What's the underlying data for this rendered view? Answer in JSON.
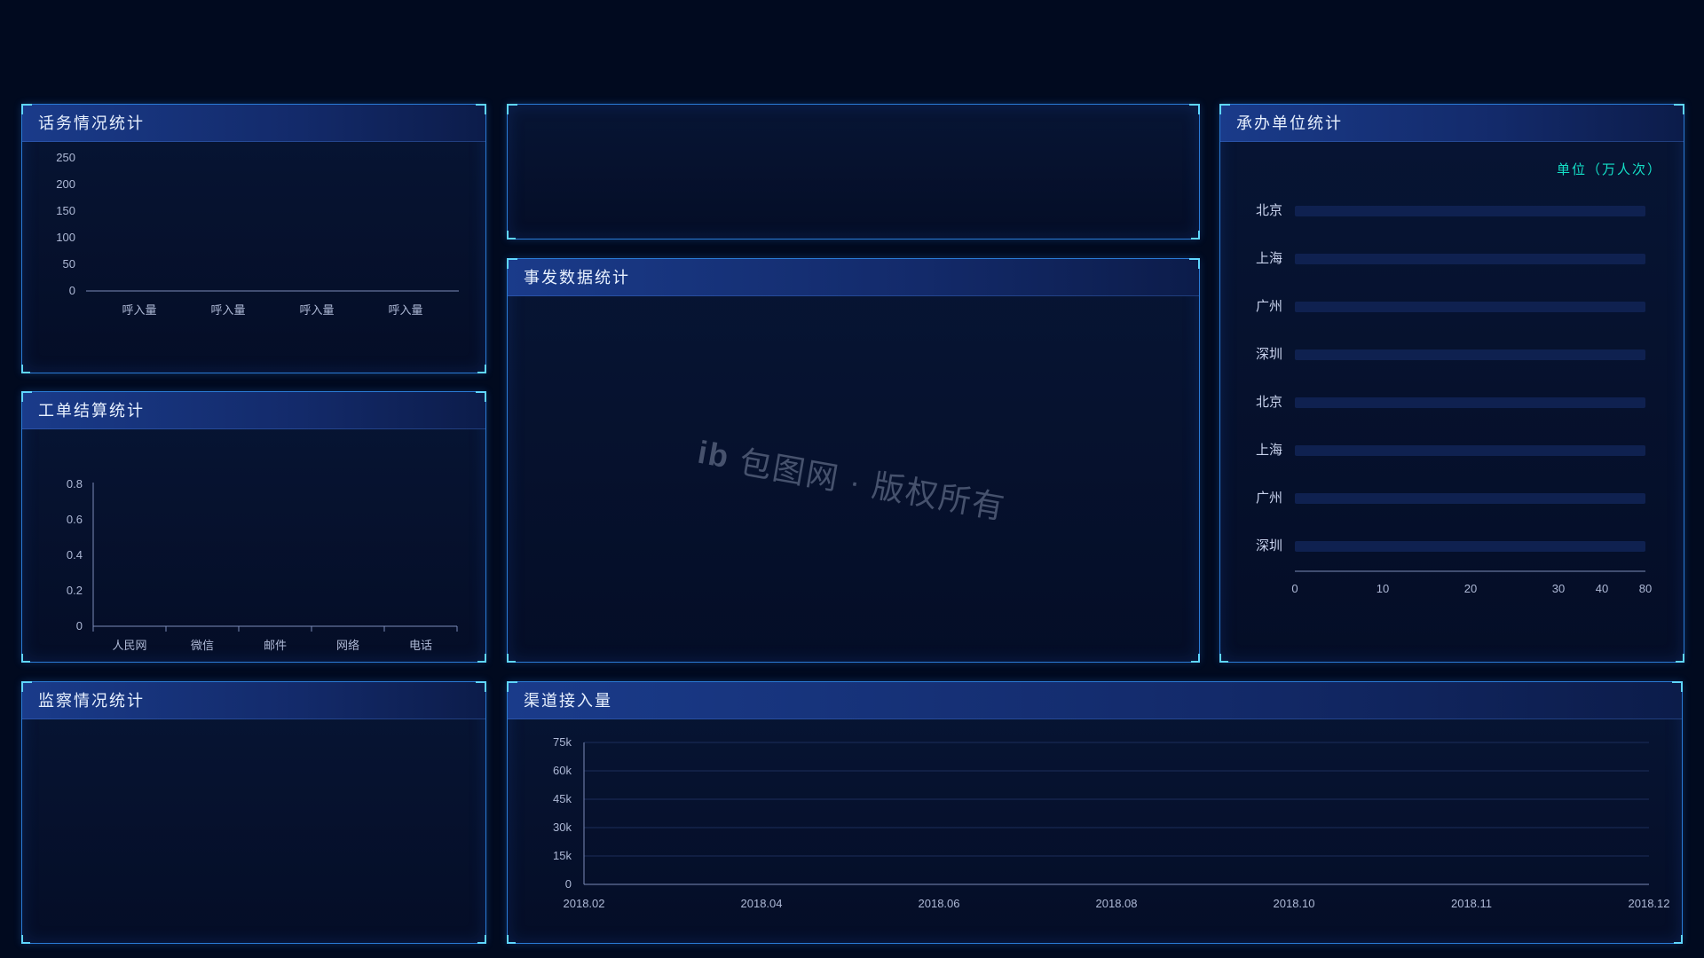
{
  "panels": {
    "call_stats": {
      "title": "话务情况统计"
    },
    "ticket_stats": {
      "title": "工单结算统计"
    },
    "monitor": {
      "title": "监察情况统计"
    },
    "top_center": {
      "title": ""
    },
    "incident": {
      "title": "事发数据统计"
    },
    "channel": {
      "title": "渠道接入量"
    },
    "agency": {
      "title": "承办单位统计",
      "unit_label": "单位（万人次）"
    }
  },
  "watermark": "包图网 · 版权所有",
  "chart_data": [
    {
      "id": "call_stats",
      "type": "bar",
      "categories": [
        "呼入量",
        "呼入量",
        "呼入量",
        "呼入量"
      ],
      "values": [
        0,
        0,
        0,
        0
      ],
      "ylabel": "",
      "xlabel": "",
      "yticks": [
        0,
        50,
        100,
        150,
        200,
        250
      ],
      "ylim": [
        0,
        250
      ]
    },
    {
      "id": "ticket_stats",
      "type": "bar",
      "categories": [
        "人民网",
        "微信",
        "邮件",
        "网络",
        "电话"
      ],
      "values": [
        0,
        0,
        0,
        0,
        0
      ],
      "yticks": [
        0.0,
        0.2,
        0.4,
        0.6,
        0.8
      ],
      "ylim": [
        0,
        0.8
      ]
    },
    {
      "id": "agency",
      "type": "bar",
      "orientation": "horizontal",
      "categories": [
        "北京",
        "上海",
        "广州",
        "深圳",
        "北京",
        "上海",
        "广州",
        "深圳"
      ],
      "values": [
        0,
        0,
        0,
        0,
        0,
        0,
        0,
        0
      ],
      "xticks": [
        0,
        10,
        20,
        30,
        40,
        80
      ],
      "xlim": [
        0,
        80
      ]
    },
    {
      "id": "channel",
      "type": "line",
      "x": [
        "2018.02",
        "2018.04",
        "2018.06",
        "2018.08",
        "2018.10",
        "2018.11",
        "2018.12"
      ],
      "series": [],
      "yticks": [
        "0",
        "15k",
        "30k",
        "45k",
        "60k",
        "75k"
      ],
      "ylim": [
        0,
        75000
      ]
    }
  ]
}
